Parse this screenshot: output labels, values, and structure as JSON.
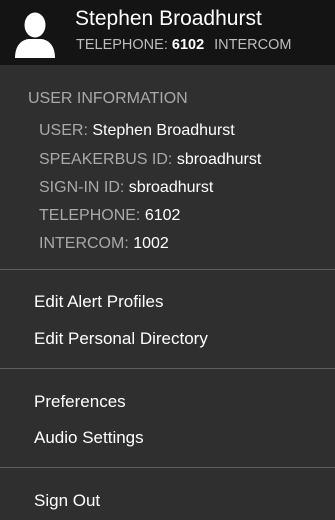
{
  "header": {
    "avatar_icon": "user-silhouette-icon",
    "name": "Stephen Broadhurst",
    "telephone_label": "TELEPHONE:",
    "telephone_value": "6102",
    "intercom_label": "INTERCOM"
  },
  "user_info": {
    "title": "USER INFORMATION",
    "rows": [
      {
        "label": "USER:",
        "value": "Stephen Broadhurst"
      },
      {
        "label": "SPEAKERBUS ID:",
        "value": "sbroadhurst"
      },
      {
        "label": "SIGN-IN ID:",
        "value": "sbroadhurst"
      },
      {
        "label": "TELEPHONE:",
        "value": "6102"
      },
      {
        "label": "INTERCOM:",
        "value": "1002"
      }
    ]
  },
  "menu": {
    "edit_alert_profiles": "Edit Alert Profiles",
    "edit_personal_directory": "Edit Personal Directory",
    "preferences": "Preferences",
    "audio_settings": "Audio Settings",
    "sign_out": "Sign Out"
  },
  "colors": {
    "header_bg": "#141414",
    "menu_bg": "#2f2f2f",
    "label_gray": "#a9a9a9",
    "divider": "#5e5e5e",
    "text": "#ffffff"
  }
}
